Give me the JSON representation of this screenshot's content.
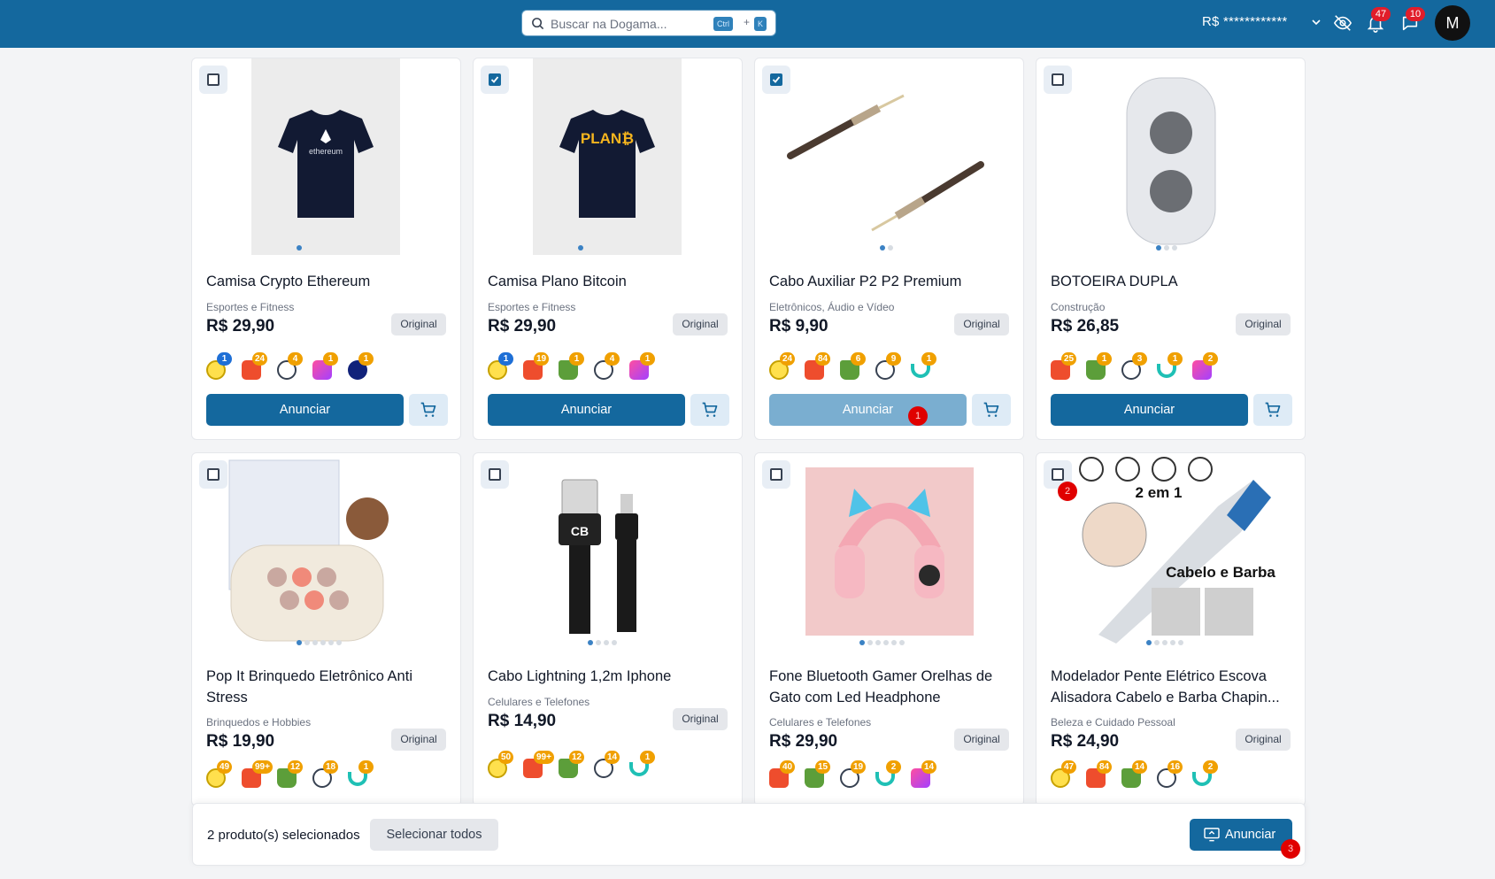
{
  "header": {
    "search_placeholder": "Buscar na Dogama...",
    "shortcut_ctrl": "Ctrl",
    "shortcut_plus": "+",
    "shortcut_key": "K",
    "balance": "R$ ************",
    "notifications_count": "47",
    "messages_count": "10",
    "avatar_initial": "M"
  },
  "products": [
    {
      "title": "Camisa Crypto Ethereum",
      "category": "Esportes e Fitness",
      "price": "R$ 29,90",
      "tag": "Original",
      "selected": false,
      "marketplaces": [
        {
          "icon": "mercadolivre-icon",
          "count": "1"
        },
        {
          "icon": "shopee-icon",
          "count": "24"
        },
        {
          "icon": "chain-icon",
          "count": "4"
        },
        {
          "icon": "kiwify-icon",
          "count": "1"
        },
        {
          "icon": "skull-icon",
          "count": "1"
        }
      ]
    },
    {
      "title": "Camisa Plano Bitcoin",
      "category": "Esportes e Fitness",
      "price": "R$ 29,90",
      "tag": "Original",
      "selected": true,
      "marketplaces": [
        {
          "icon": "mercadolivre-icon",
          "count": "1"
        },
        {
          "icon": "shopee-icon",
          "count": "19"
        },
        {
          "icon": "shopify-icon",
          "count": "1"
        },
        {
          "icon": "chain-icon",
          "count": "4"
        },
        {
          "icon": "kiwify-icon",
          "count": "1"
        }
      ]
    },
    {
      "title": "Cabo Auxiliar P2 P2 Premium",
      "category": "Eletrônicos, Áudio e Vídeo",
      "price": "R$ 9,90",
      "tag": "Original",
      "selected": true,
      "marketplaces": [
        {
          "icon": "mercadolivre-icon",
          "count": "24"
        },
        {
          "icon": "shopee-icon",
          "count": "84"
        },
        {
          "icon": "shopify-icon",
          "count": "6"
        },
        {
          "icon": "chain-icon",
          "count": "9"
        },
        {
          "icon": "nuvemshop-icon",
          "count": "1"
        }
      ]
    },
    {
      "title": "BOTOEIRA DUPLA",
      "category": "Construção",
      "price": "R$ 26,85",
      "tag": "Original",
      "selected": false,
      "marketplaces": [
        {
          "icon": "shopee-icon",
          "count": "25"
        },
        {
          "icon": "shopify-icon",
          "count": "1"
        },
        {
          "icon": "chain-icon",
          "count": "3"
        },
        {
          "icon": "nuvemshop-icon",
          "count": "1"
        },
        {
          "icon": "kiwify-icon",
          "count": "2"
        }
      ]
    },
    {
      "title": "Pop It Brinquedo Eletrônico Anti Stress",
      "category": "Brinquedos e Hobbies",
      "price": "R$ 19,90",
      "tag": "Original",
      "selected": false,
      "marketplaces": [
        {
          "icon": "mercadolivre-icon",
          "count": "49"
        },
        {
          "icon": "shopee-icon",
          "count": "99+"
        },
        {
          "icon": "shopify-icon",
          "count": "12"
        },
        {
          "icon": "chain-icon",
          "count": "18"
        },
        {
          "icon": "nuvemshop-icon",
          "count": "1"
        }
      ]
    },
    {
      "title": "Cabo Lightning 1,2m Iphone",
      "category": "Celulares e Telefones",
      "price": "R$ 14,90",
      "tag": "Original",
      "selected": false,
      "marketplaces": [
        {
          "icon": "mercadolivre-icon",
          "count": "50"
        },
        {
          "icon": "shopee-icon",
          "count": "99+"
        },
        {
          "icon": "shopify-icon",
          "count": "12"
        },
        {
          "icon": "chain-icon",
          "count": "14"
        },
        {
          "icon": "nuvemshop-icon",
          "count": "1"
        }
      ]
    },
    {
      "title": "Fone Bluetooth Gamer Orelhas de Gato com Led Headphone",
      "category": "Celulares e Telefones",
      "price": "R$ 29,90",
      "tag": "Original",
      "selected": false,
      "marketplaces": [
        {
          "icon": "shopee-icon",
          "count": "40"
        },
        {
          "icon": "shopify-icon",
          "count": "15"
        },
        {
          "icon": "chain-icon",
          "count": "19"
        },
        {
          "icon": "nuvemshop-icon",
          "count": "2"
        },
        {
          "icon": "kiwify-icon",
          "count": "14"
        }
      ]
    },
    {
      "title": "Modelador Pente Elétrico Escova Alisadora Cabelo e Barba Chapin...",
      "category": "Beleza e Cuidado Pessoal",
      "price": "R$ 24,90",
      "tag": "Original",
      "selected": false,
      "marketplaces": [
        {
          "icon": "mercadolivre-icon",
          "count": "47"
        },
        {
          "icon": "shopee-icon",
          "count": "84"
        },
        {
          "icon": "shopify-icon",
          "count": "14"
        },
        {
          "icon": "chain-icon",
          "count": "16"
        },
        {
          "icon": "nuvemshop-icon",
          "count": "2"
        }
      ]
    }
  ],
  "image_texts": {
    "p1": "ethereum",
    "p2": "PLAN₿",
    "p6": "CB",
    "p8_title": "2 em 1",
    "p8_sub": "Cabelo e Barba"
  },
  "card_actions": {
    "announce_label": "Anunciar"
  },
  "markers": [
    "1",
    "2",
    "3"
  ],
  "bottom_bar": {
    "selected_text": "2 produto(s) selecionados",
    "select_all_label": "Selecionar todos",
    "announce_label": "Anunciar"
  },
  "colors": {
    "primary": "#14689e",
    "badge": "#e11d2a",
    "marketplace_count": "#f0a000"
  }
}
